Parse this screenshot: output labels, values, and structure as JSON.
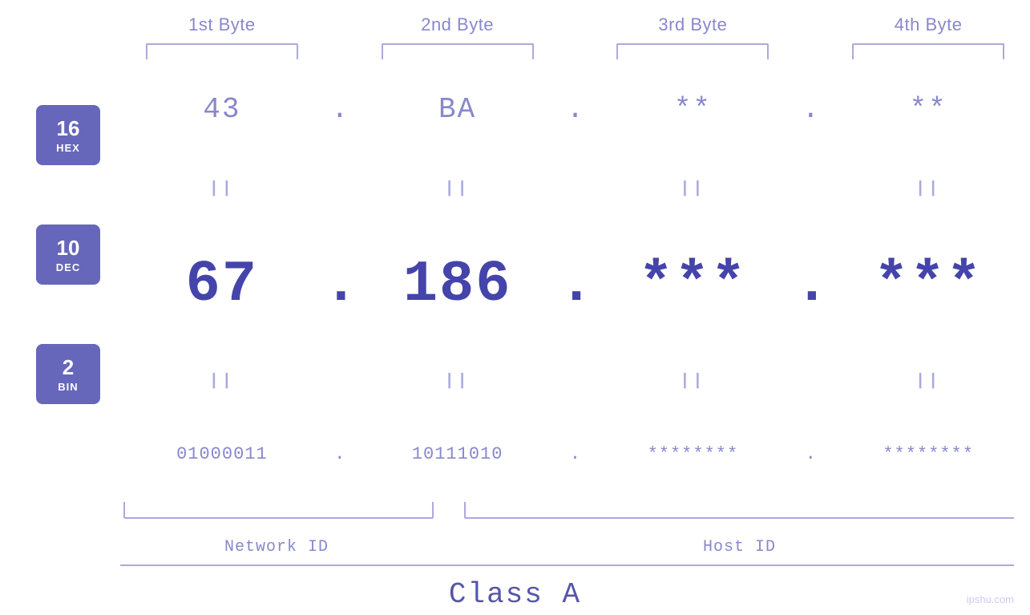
{
  "header": {
    "byte1_label": "1st Byte",
    "byte2_label": "2nd Byte",
    "byte3_label": "3rd Byte",
    "byte4_label": "4th Byte"
  },
  "bases": {
    "hex": {
      "number": "16",
      "name": "HEX"
    },
    "dec": {
      "number": "10",
      "name": "DEC"
    },
    "bin": {
      "number": "2",
      "name": "BIN"
    }
  },
  "values": {
    "hex": {
      "b1": "43",
      "b2": "BA",
      "b3": "**",
      "b4": "**"
    },
    "dec": {
      "b1": "67",
      "b2": "186",
      "b3": "***",
      "b4": "***"
    },
    "bin": {
      "b1": "01000011",
      "b2": "10111010",
      "b3": "********",
      "b4": "********"
    }
  },
  "dots": {
    "dot": "."
  },
  "equals": {
    "symbol": "||"
  },
  "labels": {
    "network_id": "Network ID",
    "host_id": "Host ID",
    "class": "Class A"
  },
  "watermark": "ipshu.com"
}
